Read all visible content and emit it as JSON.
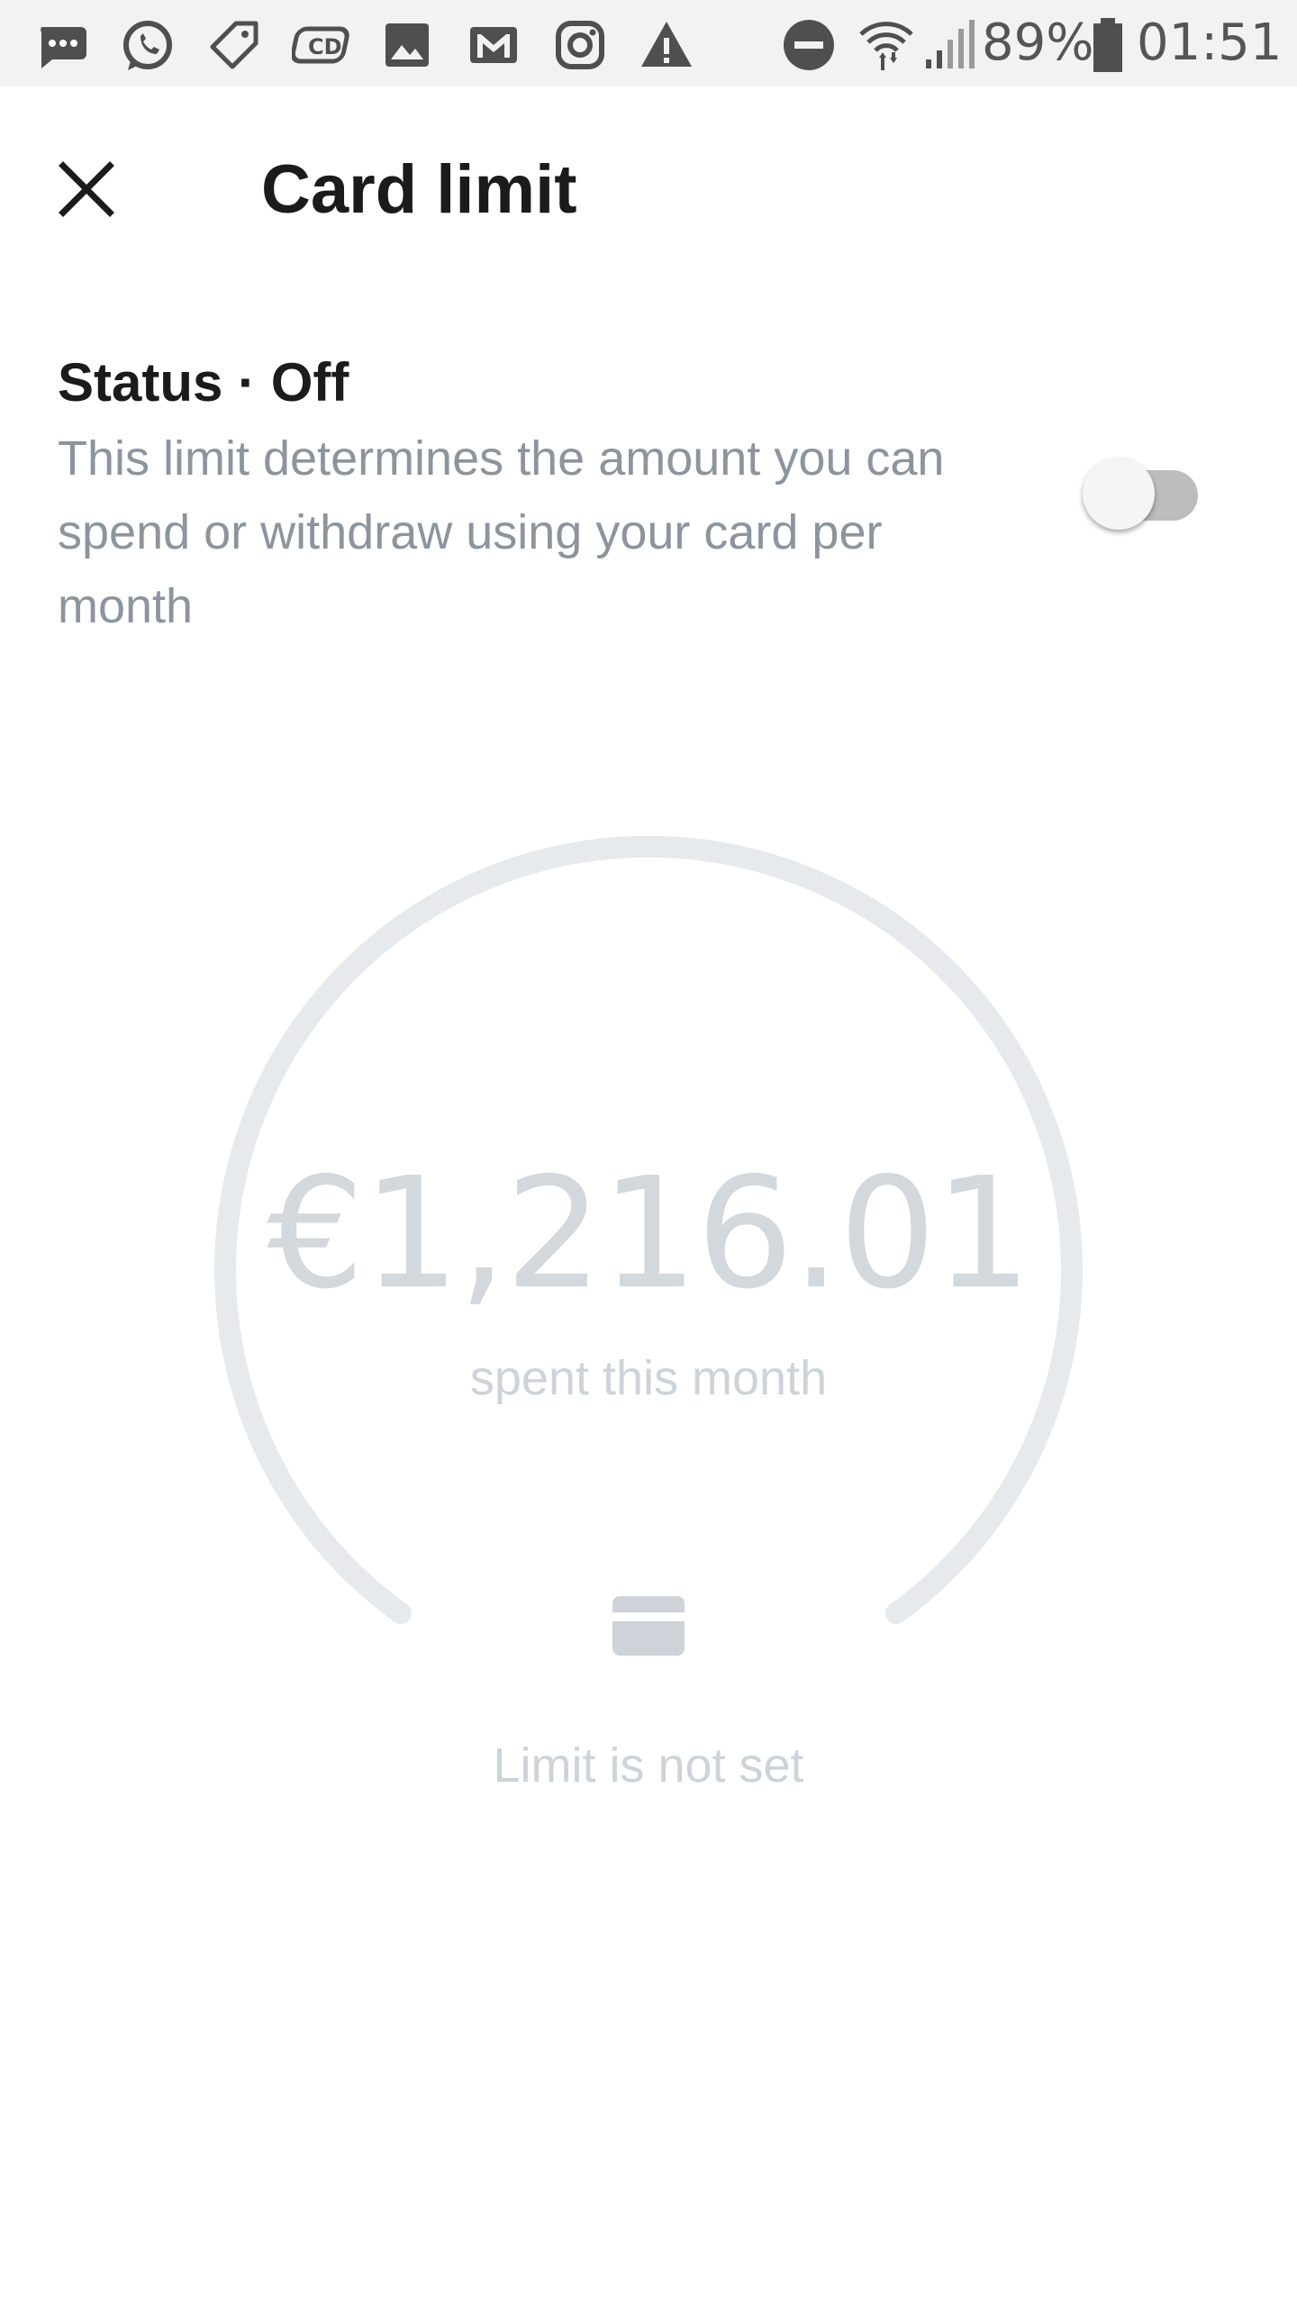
{
  "status_bar": {
    "battery_percent": "89%",
    "time": "01:51",
    "icons": [
      "messages-icon",
      "whatsapp-icon",
      "tag-icon",
      "cd-icon",
      "gallery-icon",
      "gmail-icon",
      "instagram-icon",
      "warning-icon",
      "do-not-disturb-icon",
      "wifi-icon",
      "signal-icon",
      "battery-icon"
    ]
  },
  "header": {
    "title": "Card limit",
    "close_icon": "close-icon"
  },
  "status": {
    "label": "Status · Off",
    "description": "This limit determines the amount you can spend or withdraw using your card per month",
    "toggle_on": false
  },
  "gauge": {
    "amount": "€1,216.01",
    "caption": "spent this month",
    "limit_text": "Limit is not set",
    "card_icon": "card-icon"
  },
  "colors": {
    "title": "#1b1b1b",
    "description": "#8d949c",
    "gauge_track": "#e6eaed",
    "amount": "#d3d8dd",
    "muted": "#cdd3d8",
    "toggle_track": "#bdbdbd",
    "toggle_thumb": "#f5f5f5"
  }
}
